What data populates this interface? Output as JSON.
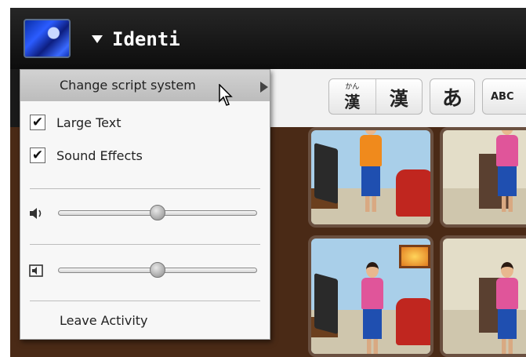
{
  "titlebar": {
    "activity_name": "Identi",
    "activity_icon": "activity-icon",
    "dropdown_icon": "triangle-down-icon"
  },
  "toolbar": {
    "buttons": [
      {
        "name": "kanji-with-furigana",
        "ruby": "かん",
        "glyph": "漢"
      },
      {
        "name": "kanji",
        "glyph": "漢"
      },
      {
        "name": "hiragana",
        "glyph": "あ"
      },
      {
        "name": "romaji",
        "glyph": "ABC"
      }
    ]
  },
  "menu": {
    "change_script": "Change script system",
    "large_text": "Large Text",
    "large_text_checked": true,
    "sound_effects": "Sound Effects",
    "sound_effects_checked": true,
    "check_glyph": "✔",
    "volume_slider": {
      "icon": "speaker-icon",
      "value": 0.5
    },
    "second_slider": {
      "icon": "speaker-box-icon",
      "value": 0.5
    },
    "leave_activity": "Leave Activity"
  },
  "colors": {
    "menu_highlight": "#c6c6c6",
    "titlebar": "#111111",
    "game_background": "#4a2a16",
    "skirt": "#1f4fb0",
    "shirt_orange": "#f08a1c",
    "shirt_pink": "#e0559a"
  }
}
